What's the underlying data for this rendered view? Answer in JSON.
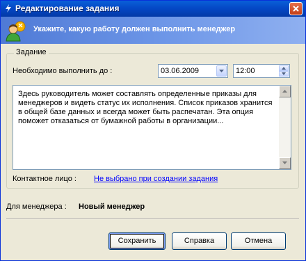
{
  "window": {
    "title": "Редактирование задания"
  },
  "banner": {
    "text": "Укажите, какую работу должен выполнить менеджер"
  },
  "task_group": {
    "legend": "Задание",
    "deadline_label": "Необходимо выполнить до :",
    "date_value": "03.06.2009",
    "time_value": "12:00",
    "description": "Здесь руководитель может составлять определенные приказы для\nменеджеров и видеть статус их исполнения. Список приказов хранится\nв общей базе данных и всегда может быть распечатан. Эта опция\nпоможет отказаться от бумажной работы в организации...",
    "contact_label": "Контактное лицо :",
    "contact_link": "Не выбрано при создании задания"
  },
  "manager": {
    "label": "Для менеджера :",
    "value": "Новый менеджер"
  },
  "buttons": {
    "save": "Сохранить",
    "help": "Справка",
    "cancel": "Отмена"
  },
  "colors": {
    "titlebar": "#0447c4",
    "banner": "#6e97e8",
    "dialog_bg": "#ece9d8",
    "link": "#0000ff"
  },
  "icons": {
    "title": "lightning-icon",
    "close": "close-icon",
    "banner": "user-task-icon",
    "dropdown": "chevron-down-icon",
    "spin_up": "arrow-up-icon",
    "spin_down": "arrow-down-icon"
  }
}
